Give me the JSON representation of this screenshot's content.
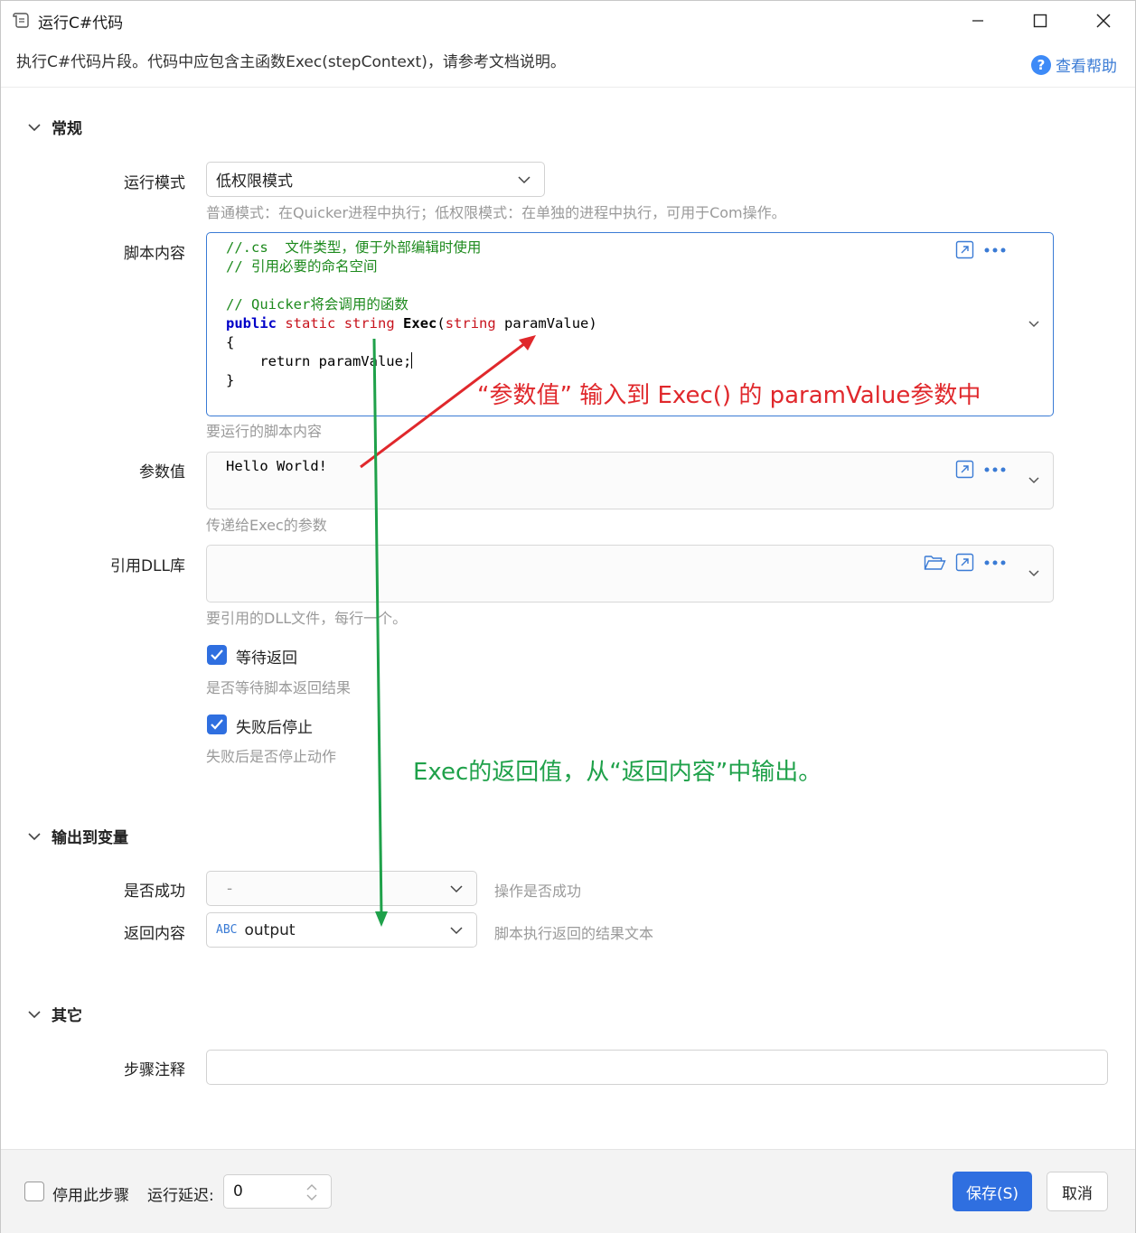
{
  "window": {
    "title": "运行C#代码",
    "description": "执行C#代码片段。代码中应包含主函数Exec(stepContext)，请参考文档说明。",
    "help_label": "查看帮助"
  },
  "sections": {
    "general": "常规",
    "output": "输出到变量",
    "other": "其它"
  },
  "run_mode": {
    "label": "运行模式",
    "value": "低权限模式",
    "hint": "普通模式：在Quicker进程中执行；低权限模式：在单独的进程中执行，可用于Com操作。"
  },
  "script": {
    "label": "脚本内容",
    "hint": "要运行的脚本内容",
    "lines": {
      "l1": "//.cs  文件类型，便于外部编辑时使用",
      "l2": "// 引用必要的命名空间",
      "l4": "// Quicker将会调用的函数",
      "kw_public": "public",
      "kw_static": "static",
      "kw_string": "string",
      "fn_exec": "Exec",
      "paren_open": "(",
      "kw_string2": "string",
      "param": "paramValue)",
      "brace_open": "{",
      "ret": "    return paramValue;",
      "brace_close": "}"
    }
  },
  "param_value": {
    "label": "参数值",
    "value": "Hello World!",
    "hint": "传递给Exec的参数"
  },
  "dll": {
    "label": "引用DLL库",
    "value": "",
    "hint": "要引用的DLL文件，每行一个。"
  },
  "wait_return": {
    "label": "等待返回",
    "checked": true,
    "hint": "是否等待脚本返回结果"
  },
  "stop_on_fail": {
    "label": "失败后停止",
    "checked": true,
    "hint": "失败后是否停止动作"
  },
  "output": {
    "success_label": "是否成功",
    "success_value": "-",
    "success_hint": "操作是否成功",
    "return_label": "返回内容",
    "return_type": "ABC",
    "return_value": "output",
    "return_hint": "脚本执行返回的结果文本"
  },
  "other": {
    "note_label": "步骤注释",
    "note_value": ""
  },
  "footer": {
    "disable_label": "停用此步骤",
    "delay_label": "运行延迟:",
    "delay_value": "0",
    "save_label": "保存(S)",
    "cancel_label": "取消"
  },
  "annotations": {
    "red": "“参数值” 输入到 Exec() 的 paramValue参数中",
    "green": "Exec的返回值，从“返回内容”中输出。"
  },
  "colors": {
    "accent": "#2f6fe0",
    "annotation_red": "#e0282c",
    "annotation_green": "#1fa14a",
    "code_comment": "#1d8a1d",
    "code_keyword": "#0000c8",
    "code_type": "#c8141e"
  }
}
